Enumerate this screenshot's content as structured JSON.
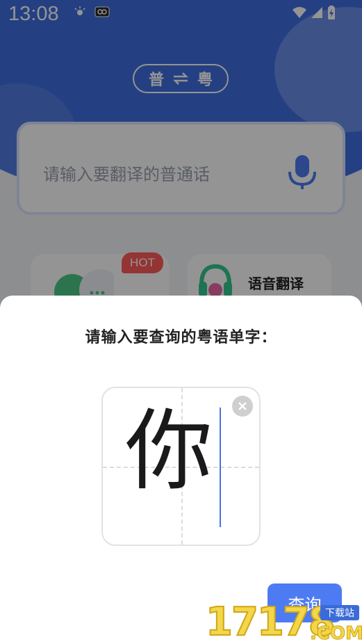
{
  "status_bar": {
    "time": "13:08"
  },
  "background_app": {
    "lang_toggle": {
      "from": "普",
      "to": "粤"
    },
    "input_placeholder": "请输入要翻译的普通话",
    "hot_badge": "HOT",
    "feature_right_label": "语音翻译"
  },
  "dialog": {
    "title": "请输入要查询的粤语单字：",
    "input_value": "你",
    "query_button": "查询"
  },
  "watermark": {
    "number": "17178",
    "tag": "下载站",
    "suffix": ".COM"
  },
  "colors": {
    "primary": "#4d7bf2",
    "hero": "#3f6fe0",
    "hot": "#ff5a5a",
    "watermark_yellow": "#f3d64a"
  }
}
